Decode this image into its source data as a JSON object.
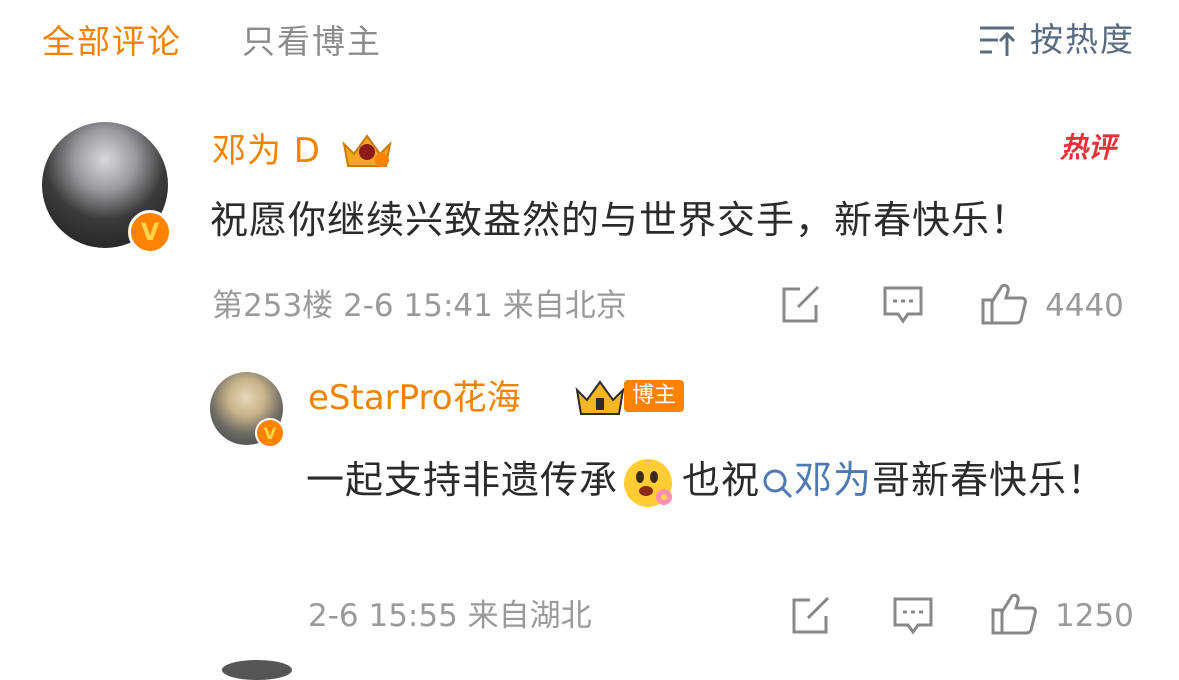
{
  "tabs": {
    "all_comments": "全部评论",
    "blogger_only": "只看博主",
    "sort_label": "按热度"
  },
  "colors": {
    "accent": "#f08300",
    "hot": "#e8303a",
    "mention": "#4d7ab2"
  },
  "comments": [
    {
      "username": "邓为 D",
      "hot_label": "热评",
      "text": "祝愿你继续兴致盎然的与世界交手，新春快乐！",
      "meta": "第253楼  2-6 15:41  来自北京",
      "likes": "4440",
      "icons": [
        "verified-v-icon",
        "crown-level-icon",
        "share-icon",
        "comment-icon",
        "like-icon"
      ]
    },
    {
      "username": "eStarPro花海",
      "blogger_badge": "博主",
      "text_before": "一起支持非遗传承",
      "text_middle": "也祝",
      "mention": "邓为",
      "text_after": "哥新春快乐！",
      "meta": "2-6 15:55  来自湖北",
      "likes": "1250",
      "icons": [
        "verified-v-icon",
        "crown-ii-icon",
        "flower-emoji-icon",
        "search-mention-icon",
        "share-icon",
        "comment-icon",
        "like-icon"
      ]
    }
  ]
}
